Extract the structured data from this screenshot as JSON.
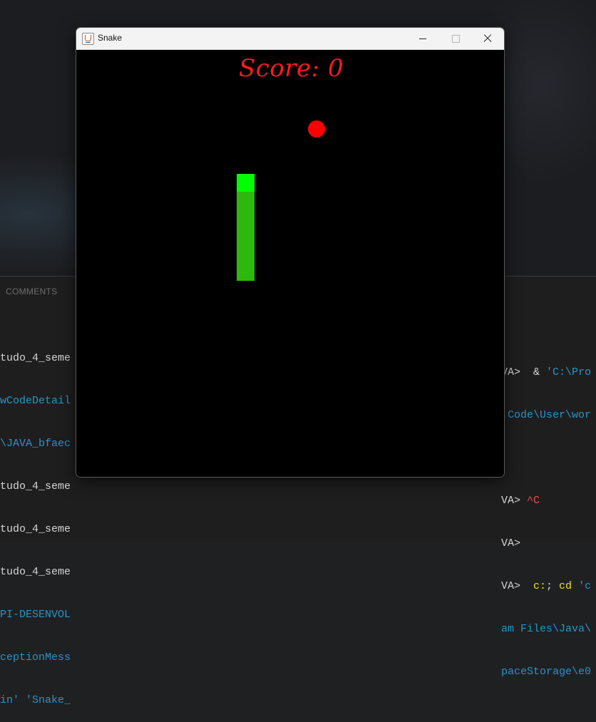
{
  "window": {
    "title": "Snake",
    "controls": {
      "minimize": "minimize",
      "maximize": "maximize",
      "close": "close"
    }
  },
  "game": {
    "score_text": "Score: 0",
    "colors": {
      "food": "#ff0000",
      "snake_head": "#00ff00",
      "snake_body": "#2db80e",
      "background": "#000000",
      "score": "#ff1a1a"
    }
  },
  "terminal": {
    "comments_label": "COMMENTS",
    "lines": [
      {
        "left": "tudo_4_seme",
        "right_prompt": "VA>",
        "right_cmd": "  & 'C:\\Pro"
      },
      {
        "left": "wCodeDetail",
        "right_prompt": "",
        "right_cmd": ".Code\\User\\wor"
      },
      {
        "left": "\\JAVA_bfaec",
        "right_prompt": "",
        "right_cmd": ""
      },
      {
        "left": "tudo_4_seme",
        "right_prompt": "VA>",
        "right_cmd": " ^C"
      },
      {
        "left": "tudo_4_seme",
        "right_prompt": "VA>",
        "right_cmd": ""
      },
      {
        "left": "tudo_4_seme",
        "right_prompt": "VA>",
        "right_cmd": "  c:; cd 'c"
      },
      {
        "left": "PI-DESENVOL",
        "right_prompt": "",
        "right_cmd": "am Files\\Java\\"
      },
      {
        "left": "ceptionMess",
        "right_prompt": "",
        "right_cmd": "paceStorage\\e0"
      },
      {
        "left": "in' 'Snake_",
        "right_prompt": "",
        "right_cmd": ""
      }
    ]
  }
}
